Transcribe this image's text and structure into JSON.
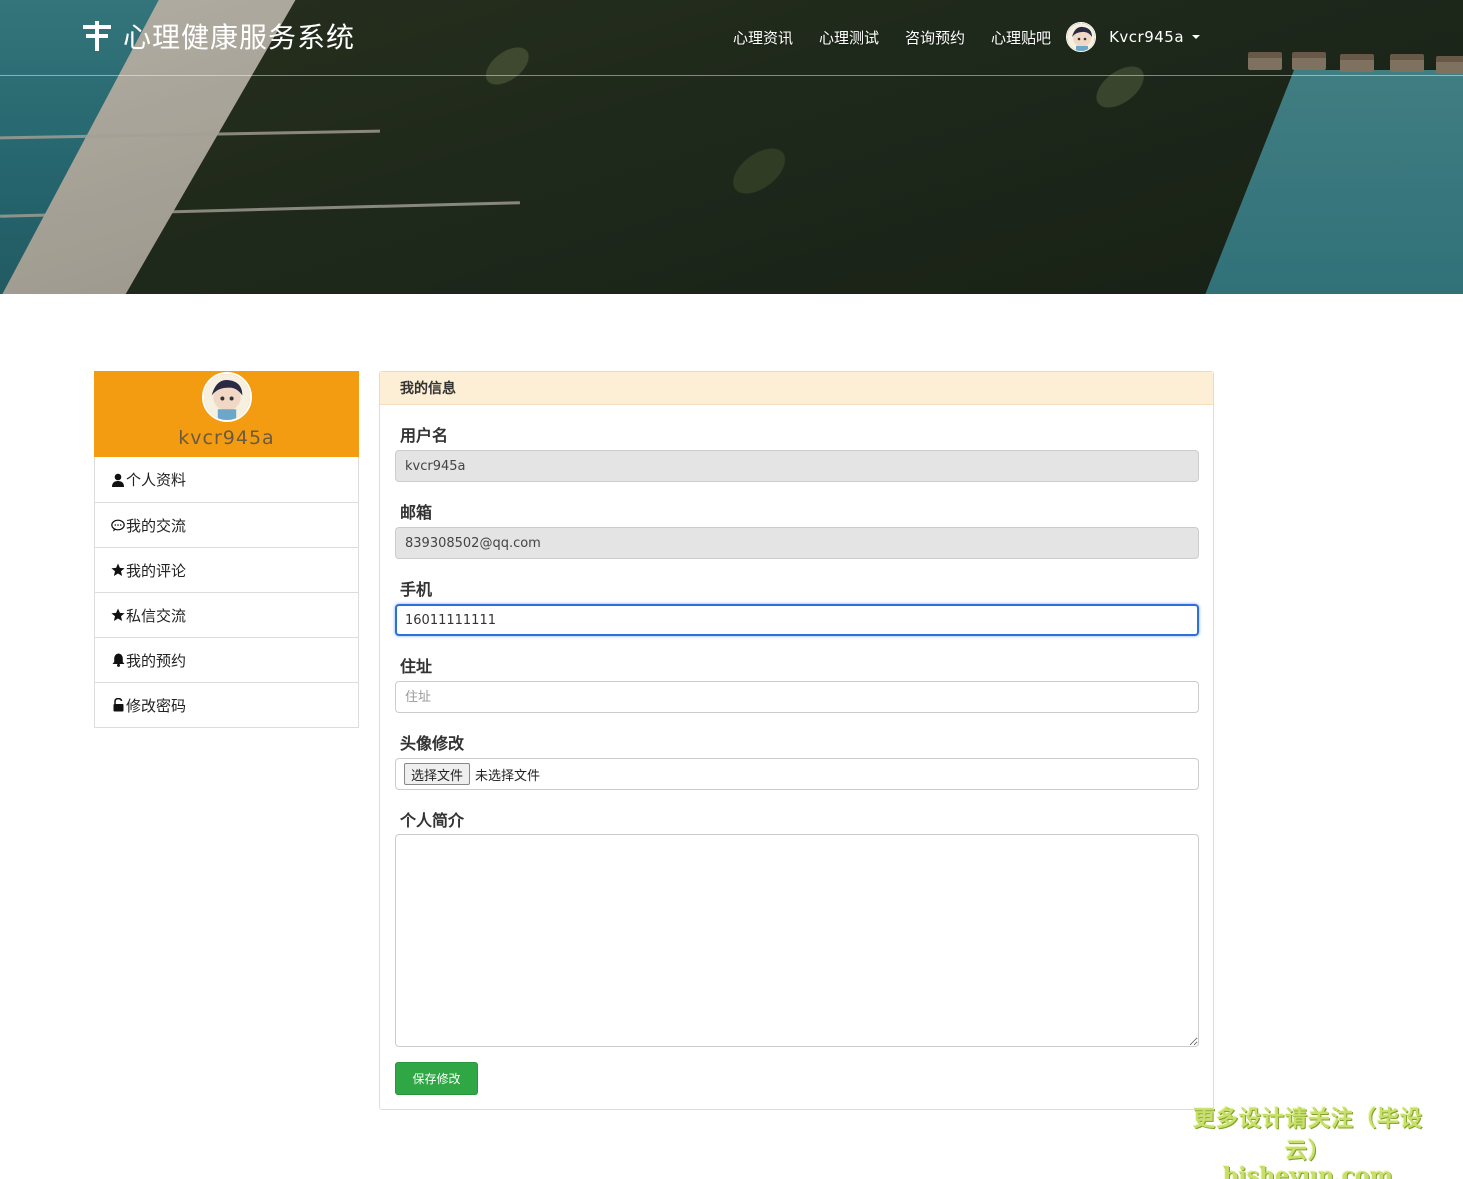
{
  "header": {
    "brand": "心理健康服务系统",
    "nav": [
      "心理资讯",
      "心理测试",
      "咨询预约",
      "心理贴吧"
    ],
    "user_name": "Kvcr945a"
  },
  "sidebar": {
    "profile_name": "kvcr945a",
    "items": [
      {
        "label": "个人资料",
        "icon": "user-icon"
      },
      {
        "label": "我的交流",
        "icon": "comment-icon"
      },
      {
        "label": "我的评论",
        "icon": "star-icon"
      },
      {
        "label": "私信交流",
        "icon": "star-icon"
      },
      {
        "label": "我的预约",
        "icon": "bell-icon"
      },
      {
        "label": "修改密码",
        "icon": "unlock-icon"
      }
    ]
  },
  "form": {
    "title": "我的信息",
    "username_label": "用户名",
    "username_value": "kvcr945a",
    "email_label": "邮箱",
    "email_value": "839308502@qq.com",
    "phone_label": "手机",
    "phone_value": "16011111111",
    "address_label": "住址",
    "address_placeholder": "住址",
    "avatar_label": "头像修改",
    "file_button": "选择文件",
    "file_status": "未选择文件",
    "bio_label": "个人简介",
    "bio_value": "",
    "save_label": "保存修改"
  },
  "watermark": {
    "line1": "更多设计请关注（毕设云）",
    "line2": "bisheyun.com"
  },
  "colors": {
    "sidebar_header": "#f39c12",
    "panel_heading": "#fdefd5",
    "save_button": "#2fa745",
    "focus_border": "#2d6fdc"
  }
}
